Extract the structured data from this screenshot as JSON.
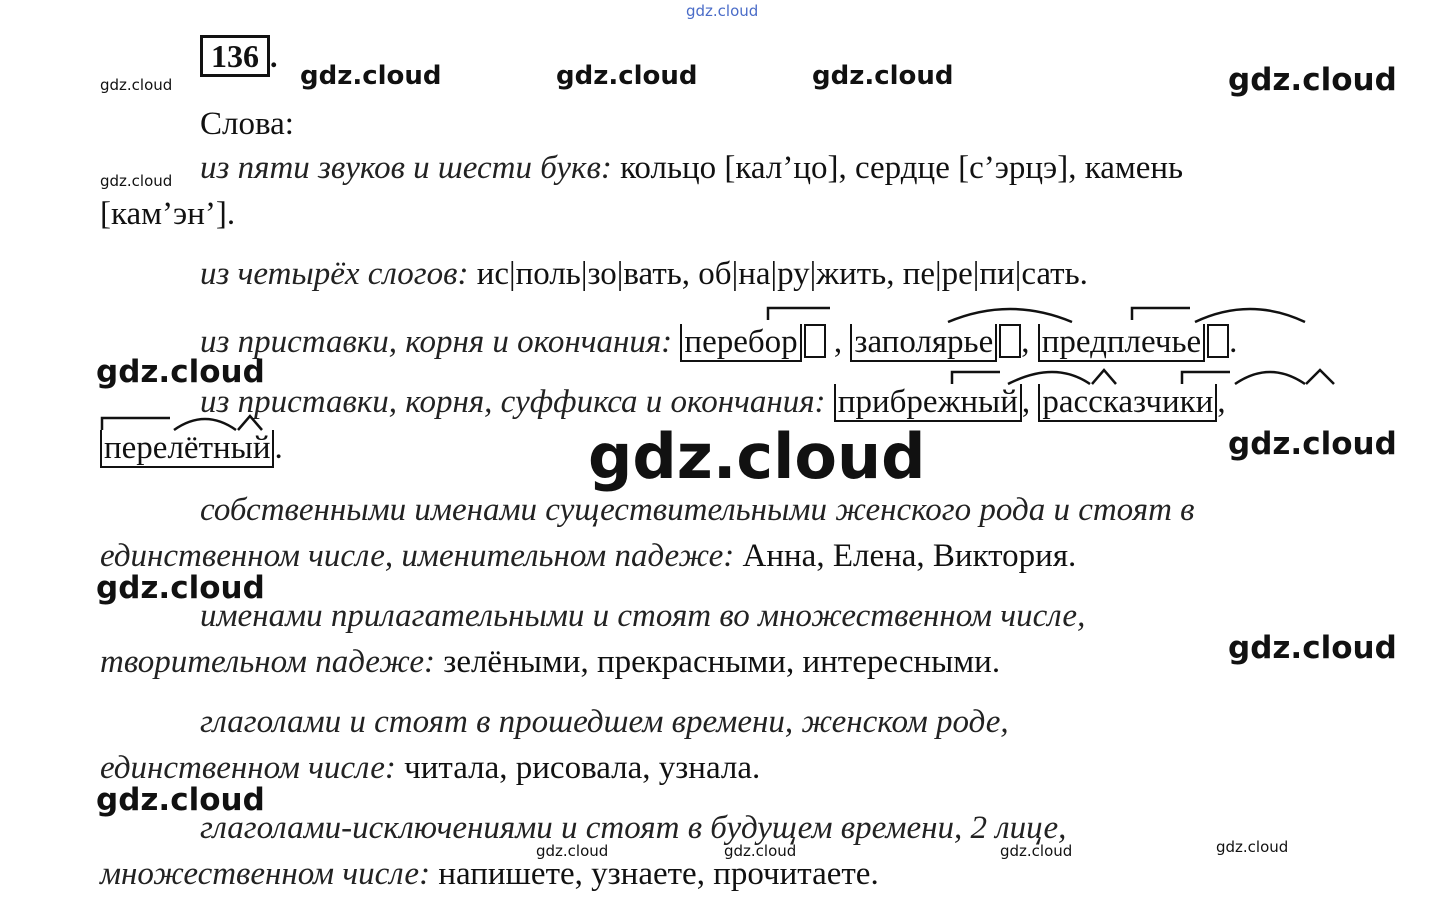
{
  "watermark": "gdz.cloud",
  "exercise": {
    "number": "136",
    "dot": "."
  },
  "intro": "Слова:",
  "items": [
    {
      "label": "из пяти звуков и шести букв:",
      "text1": "кольцо [кал’цо], сердце [с’эрцэ], камень",
      "text2": "[кам’эн’]."
    },
    {
      "label": "из четырёх слогов:",
      "text1": "ис|поль|зо|вать, об|на|ру|жить, пе|ре|пи|сать."
    },
    {
      "label": "из приставки, корня и окончания:",
      "w1": "перебор",
      "sep1": ",",
      "w2": "заполярье",
      "sep2": ",",
      "w3": "предплечье",
      "end": "."
    },
    {
      "label": "из приставки, корня, суффикса и окончания:",
      "w1": "прибрежный",
      "sep1": ",",
      "w2": "рассказчики",
      "sep2": ",",
      "w3": "перелётный",
      "end": "."
    },
    {
      "label1": "собственными именами существительными женского рода и стоят в",
      "label2": "единственном числе, именительном падеже:",
      "text": "Анна, Елена, Виктория."
    },
    {
      "label1": "именами прилагательными и стоят во множественном числе,",
      "label2": "творительном падеже:",
      "text": "зелёными, прекрасными, интересными."
    },
    {
      "label1": "глаголами и стоят в прошедшем времени, женском роде,",
      "label2": "единственном числе:",
      "text": "читала, рисовала, узнала."
    },
    {
      "label1": "глаголами-исключениями и стоят в будущем времени, 2 лице,",
      "label2": "множественном числе:",
      "text": "напишете, узнаете, прочитаете."
    }
  ]
}
